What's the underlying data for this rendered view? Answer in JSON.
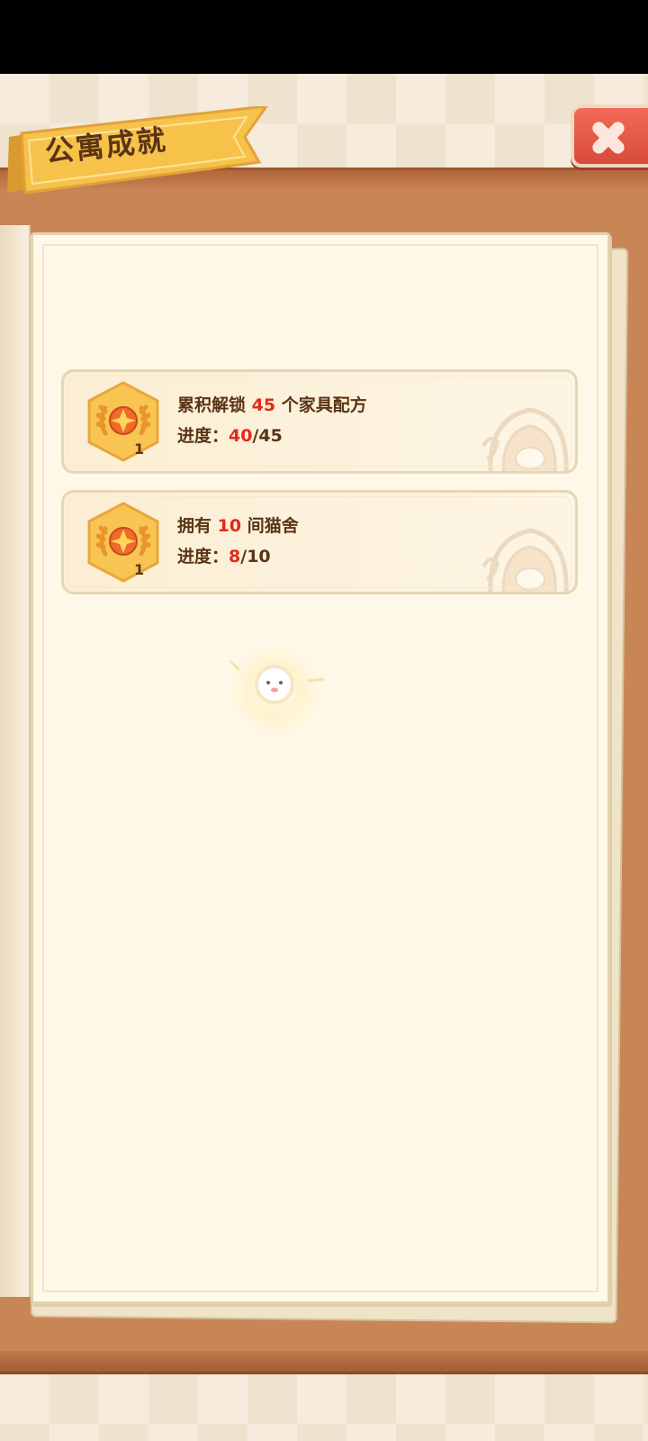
{
  "header": {
    "title": "公寓成就",
    "close_icon": "close-icon"
  },
  "achievements": [
    {
      "title_prefix": "累积解锁 ",
      "title_highlight": "45",
      "title_suffix": " 个家具配方",
      "progress_label": "进度：",
      "progress_current": "40",
      "progress_total": "/45",
      "level": "1",
      "badge_icon": "laurel-medal-icon"
    },
    {
      "title_prefix": "拥有 ",
      "title_highlight": "10",
      "title_suffix": " 间猫舍",
      "progress_label": "进度：",
      "progress_current": "8",
      "progress_total": "/10",
      "level": "1",
      "badge_icon": "laurel-medal-icon"
    }
  ],
  "colors": {
    "highlight": "#e22a1b",
    "text": "#5b3416",
    "close_button": "#d94a3a",
    "banner": "#f7c24a",
    "wood": "#c88657",
    "page": "#fff8e8"
  }
}
